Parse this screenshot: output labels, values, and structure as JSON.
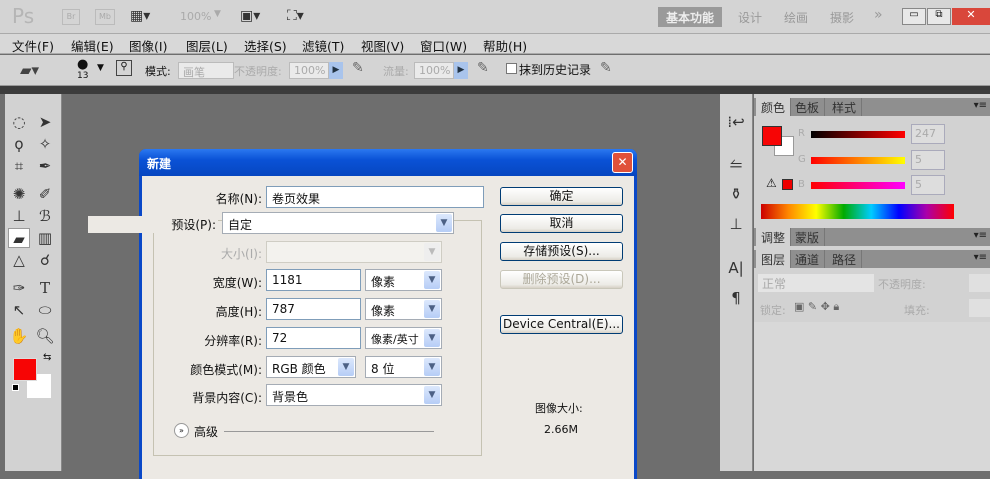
{
  "app": {
    "logo": "Ps",
    "br": "Br",
    "mb": "Mb",
    "zoom": "100%",
    "workspaces": [
      "基本功能",
      "设计",
      "绘画",
      "摄影"
    ],
    "more": "»"
  },
  "window_controls": {
    "minimize": "▭",
    "restore": "⧉",
    "close": "✕"
  },
  "menu": [
    "文件(F)",
    "编辑(E)",
    "图像(I)",
    "图层(L)",
    "选择(S)",
    "滤镜(T)",
    "视图(V)",
    "窗口(W)",
    "帮助(H)"
  ],
  "options": {
    "brush_size": "13",
    "mode_label": "模式:",
    "mode_value": "画笔",
    "opacity_label": "不透明度:",
    "opacity_value": "100%",
    "flow_label": "流量:",
    "flow_value": "100%",
    "erase_history_label": "抹到历史记录"
  },
  "color_panel": {
    "tabs": [
      "颜色",
      "色板",
      "样式"
    ],
    "channels": [
      {
        "name": "R",
        "value": "247"
      },
      {
        "name": "G",
        "value": "5"
      },
      {
        "name": "B",
        "value": "5"
      }
    ],
    "foreground": "#f70505",
    "background": "#ffffff"
  },
  "adjust_panel": {
    "tabs": [
      "调整",
      "蒙版"
    ]
  },
  "layers_panel": {
    "tabs": [
      "图层",
      "通道",
      "路径"
    ],
    "blend": "正常",
    "opacity_label": "不透明度:",
    "lock_label": "锁定:",
    "fill_label": "填充:"
  },
  "dialog": {
    "title": "新建",
    "name_label": "名称(N):",
    "name_value": "卷页效果",
    "preset_label": "预设(P):",
    "preset_value": "自定",
    "size_label": "大小(I):",
    "size_value": "",
    "width_label": "宽度(W):",
    "width_value": "1181",
    "width_unit": "像素",
    "height_label": "高度(H):",
    "height_value": "787",
    "height_unit": "像素",
    "resolution_label": "分辨率(R):",
    "resolution_value": "72",
    "resolution_unit": "像素/英寸",
    "color_mode_label": "颜色模式(M):",
    "color_mode_value": "RGB 颜色",
    "bit_depth": "8 位",
    "background_label": "背景内容(C):",
    "background_value": "背景色",
    "advanced_label": "高级",
    "ok": "确定",
    "cancel": "取消",
    "save_preset": "存储预设(S)...",
    "delete_preset": "删除预设(D)...",
    "device_central": "Device Central(E)...",
    "image_size_label": "图像大小:",
    "image_size_value": "2.66M"
  }
}
